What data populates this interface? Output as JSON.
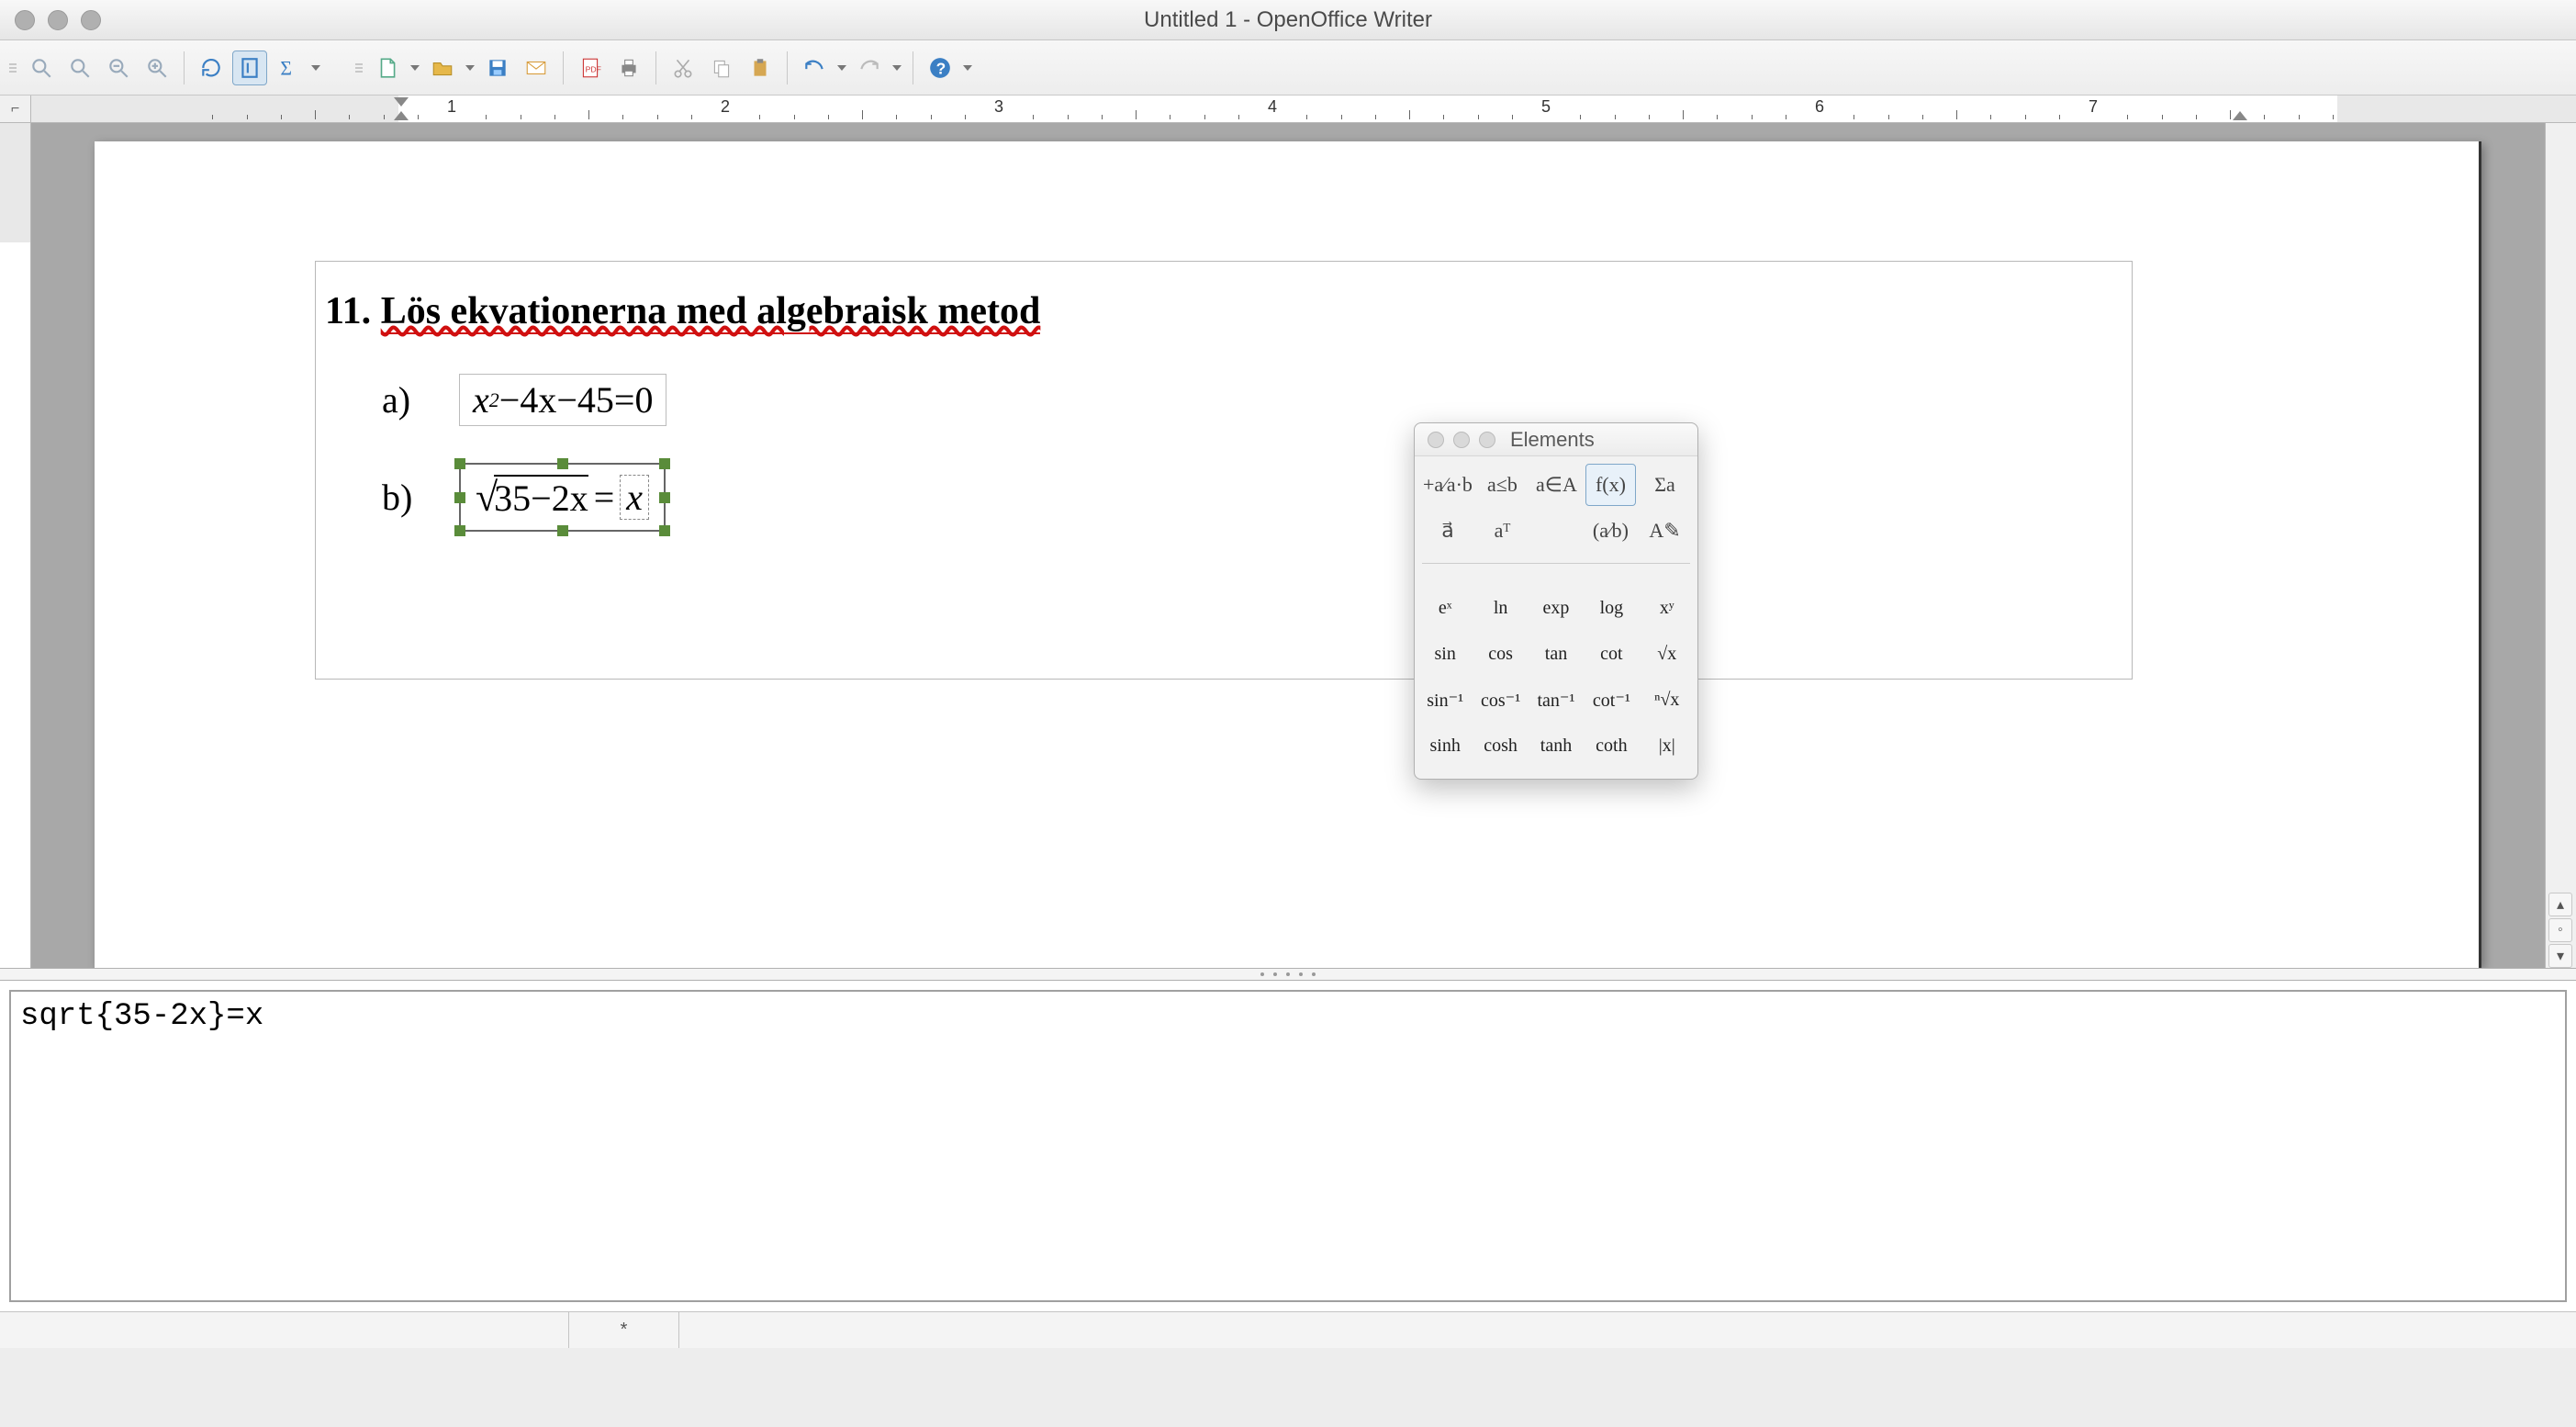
{
  "window": {
    "title": "Untitled 1 - OpenOffice Writer"
  },
  "ruler": {
    "corner": "⌐",
    "units": [
      "1",
      "2",
      "3",
      "4",
      "5",
      "6",
      "7"
    ]
  },
  "document": {
    "heading_prefix": "11. ",
    "heading_text": "Lös ekvationerna med algebraisk metod",
    "eq_a_label": "a)",
    "eq_a_expr_lhs": "x",
    "eq_a_expr_sup": "2",
    "eq_a_expr_rest": "−4x−45=0",
    "eq_b_label": "b)",
    "eq_b_sqrt_inner": "35−2x",
    "eq_b_eq": "=",
    "eq_b_rhs": "x"
  },
  "elements_panel": {
    "title": "Elements",
    "categories_row1": [
      "+a⁄a·b",
      "a≤b",
      "a∈A",
      "f(x)",
      "Σa"
    ],
    "categories_row2": [
      "a⃗",
      "aᵀ",
      "",
      "(a⁄b)",
      "A✎"
    ],
    "selected_category_index": 3,
    "items": [
      "eˣ",
      "ln",
      "exp",
      "log",
      "xʸ",
      "sin",
      "cos",
      "tan",
      "cot",
      "√x",
      "sin⁻¹",
      "cos⁻¹",
      "tan⁻¹",
      "cot⁻¹",
      "ⁿ√x",
      "sinh",
      "cosh",
      "tanh",
      "coth",
      "|x|"
    ]
  },
  "formula_editor": {
    "value": "sqrt{35-2x}=x"
  },
  "statusbar": {
    "seg1": "",
    "seg2": "*"
  },
  "icons": {
    "zoom_page": "zoom-page",
    "zoom_100": "zoom-100",
    "zoom_out": "zoom-out",
    "zoom_in": "zoom-in",
    "update": "update",
    "formula_cursor": "formula-cursor",
    "sigma": "sigma",
    "new": "new",
    "open": "open",
    "save": "save",
    "email": "email",
    "pdf": "pdf",
    "print": "print",
    "cut": "cut",
    "copy": "copy",
    "paste": "paste",
    "undo": "undo",
    "redo": "redo",
    "help": "help"
  }
}
